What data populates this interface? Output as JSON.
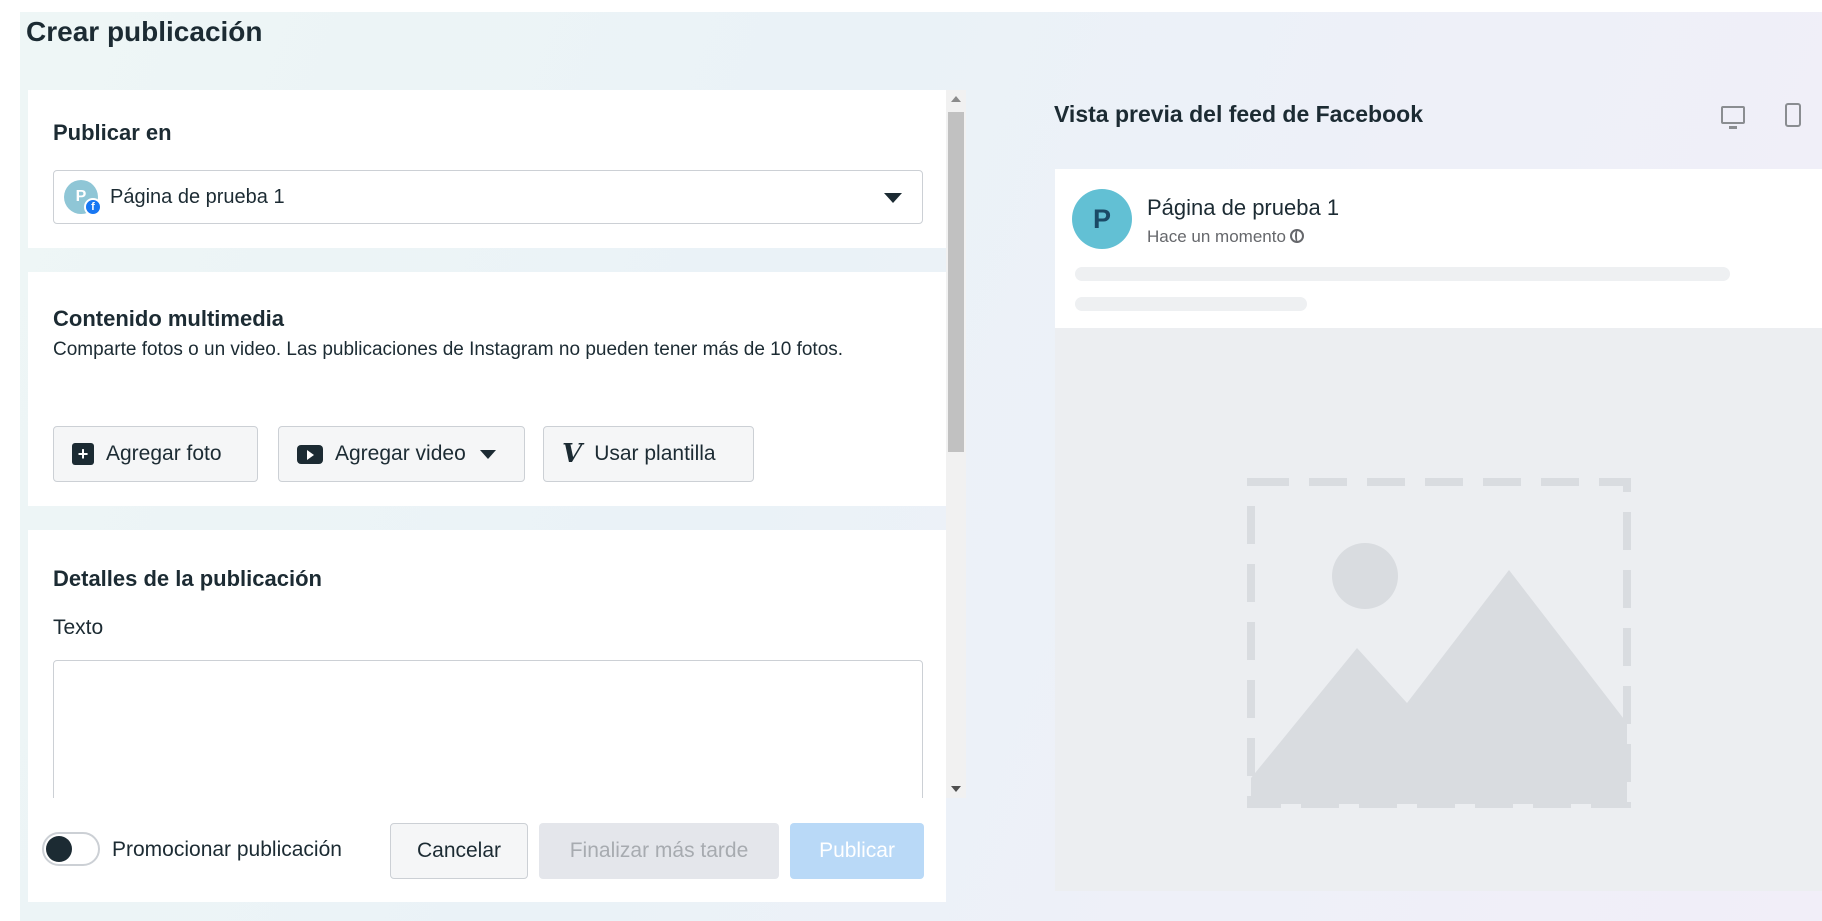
{
  "page": {
    "title": "Crear publicación"
  },
  "publish_in": {
    "title": "Publicar en",
    "selected_page": "Página de prueba 1",
    "avatar_letter": "P"
  },
  "media": {
    "title": "Contenido multimedia",
    "description": "Comparte fotos o un video. Las publicaciones de Instagram no pueden tener más de 10 fotos.",
    "buttons": {
      "add_photo": "Agregar foto",
      "add_video": "Agregar video",
      "use_template": "Usar plantilla"
    }
  },
  "details": {
    "title": "Detalles de la publicación",
    "text_label": "Texto",
    "text_value": ""
  },
  "footer": {
    "promote_label": "Promocionar publicación",
    "promote_enabled": false,
    "cancel": "Cancelar",
    "finish_later": "Finalizar más tarde",
    "publish": "Publicar"
  },
  "preview": {
    "title": "Vista previa del feed de Facebook",
    "page_name": "Página de prueba 1",
    "avatar_letter": "P",
    "time": "Hace un momento"
  },
  "colors": {
    "text": "#1c2b33",
    "publish_disabled_bg": "#b9d9f7",
    "avatar_preview": "#62c0d4",
    "facebook_blue": "#1877f2"
  }
}
